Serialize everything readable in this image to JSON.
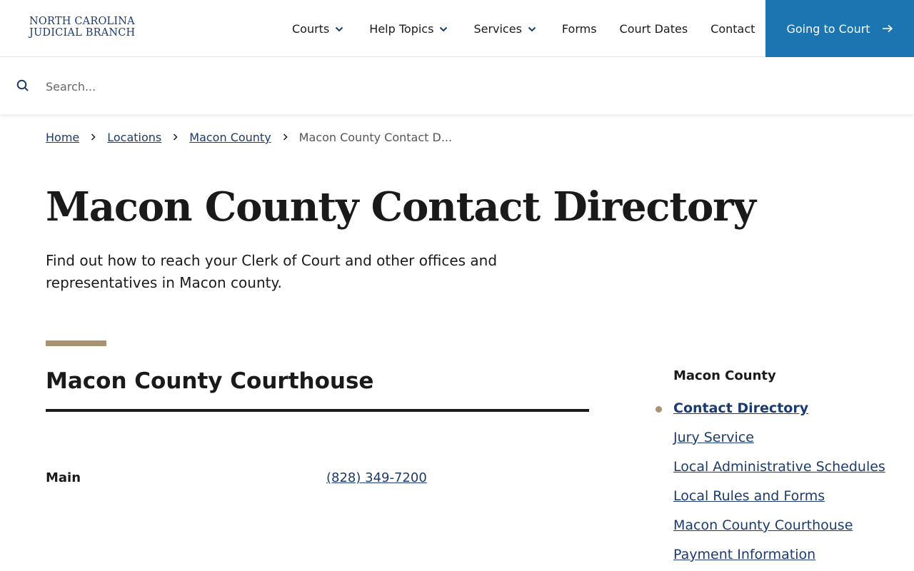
{
  "header": {
    "logo_line1": "NORTH CAROLINA",
    "logo_line2": "JUDICIAL BRANCH",
    "nav": [
      {
        "label": "Courts",
        "dropdown": true
      },
      {
        "label": "Help Topics",
        "dropdown": true
      },
      {
        "label": "Services",
        "dropdown": true
      },
      {
        "label": "Forms",
        "dropdown": false
      },
      {
        "label": "Court Dates",
        "dropdown": false
      },
      {
        "label": "Contact",
        "dropdown": false
      }
    ],
    "cta_label": "Going to Court",
    "cta_icon": "arrow-right-icon",
    "brand_color": "#1c74b0"
  },
  "search": {
    "placeholder": "Search...",
    "value": ""
  },
  "breadcrumb": {
    "items": [
      "Home",
      "Locations",
      "Macon County"
    ],
    "current": "Macon County Contact D..."
  },
  "main": {
    "title": "Macon County Contact Directory",
    "intro": "Find out how to reach your Clerk of Court and other offices and representatives in Macon county.",
    "section": {
      "title": "Macon County Courthouse",
      "rows": [
        {
          "label": "Main",
          "value": "(828) 349-7200"
        }
      ]
    },
    "accent_color": "#a89370"
  },
  "sidebar": {
    "heading": "Macon County",
    "items": [
      {
        "label": "Contact Directory",
        "active": true
      },
      {
        "label": "Jury Service",
        "active": false
      },
      {
        "label": "Local Administrative Schedules",
        "active": false
      },
      {
        "label": "Local Rules and Forms",
        "active": false
      },
      {
        "label": "Macon County Courthouse",
        "active": false
      },
      {
        "label": "Payment Information",
        "active": false
      }
    ]
  }
}
